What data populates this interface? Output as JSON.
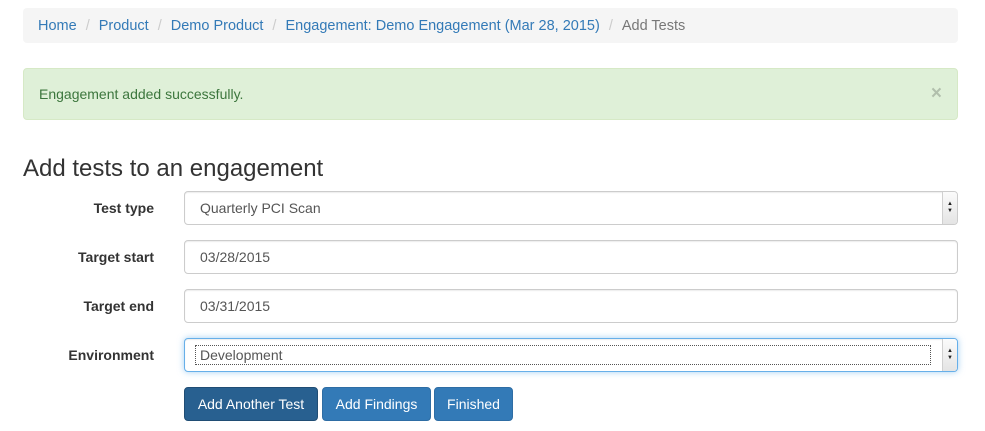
{
  "breadcrumb": {
    "items": [
      {
        "label": "Home"
      },
      {
        "label": "Product"
      },
      {
        "label": "Demo Product"
      },
      {
        "label": "Engagement: Demo Engagement (Mar 28, 2015)"
      }
    ],
    "separator": "/",
    "active": "Add Tests"
  },
  "alert": {
    "message": "Engagement added successfully.",
    "close": "×"
  },
  "page": {
    "title": "Add tests to an engagement"
  },
  "form": {
    "test_type": {
      "label": "Test type",
      "value": "Quarterly PCI Scan"
    },
    "target_start": {
      "label": "Target start",
      "value": "03/28/2015"
    },
    "target_end": {
      "label": "Target end",
      "value": "03/31/2015"
    },
    "environment": {
      "label": "Environment",
      "value": "Development"
    }
  },
  "buttons": {
    "add_another": "Add Another Test",
    "add_findings": "Add Findings",
    "finished": "Finished"
  },
  "icons": {
    "select_arrow_up": "▲",
    "select_arrow_down": "▼"
  },
  "colors": {
    "link": "#337ab7",
    "primary": "#337ab7",
    "primary_active": "#286090",
    "success_bg": "#dff0d8",
    "success_text": "#3c763d"
  }
}
